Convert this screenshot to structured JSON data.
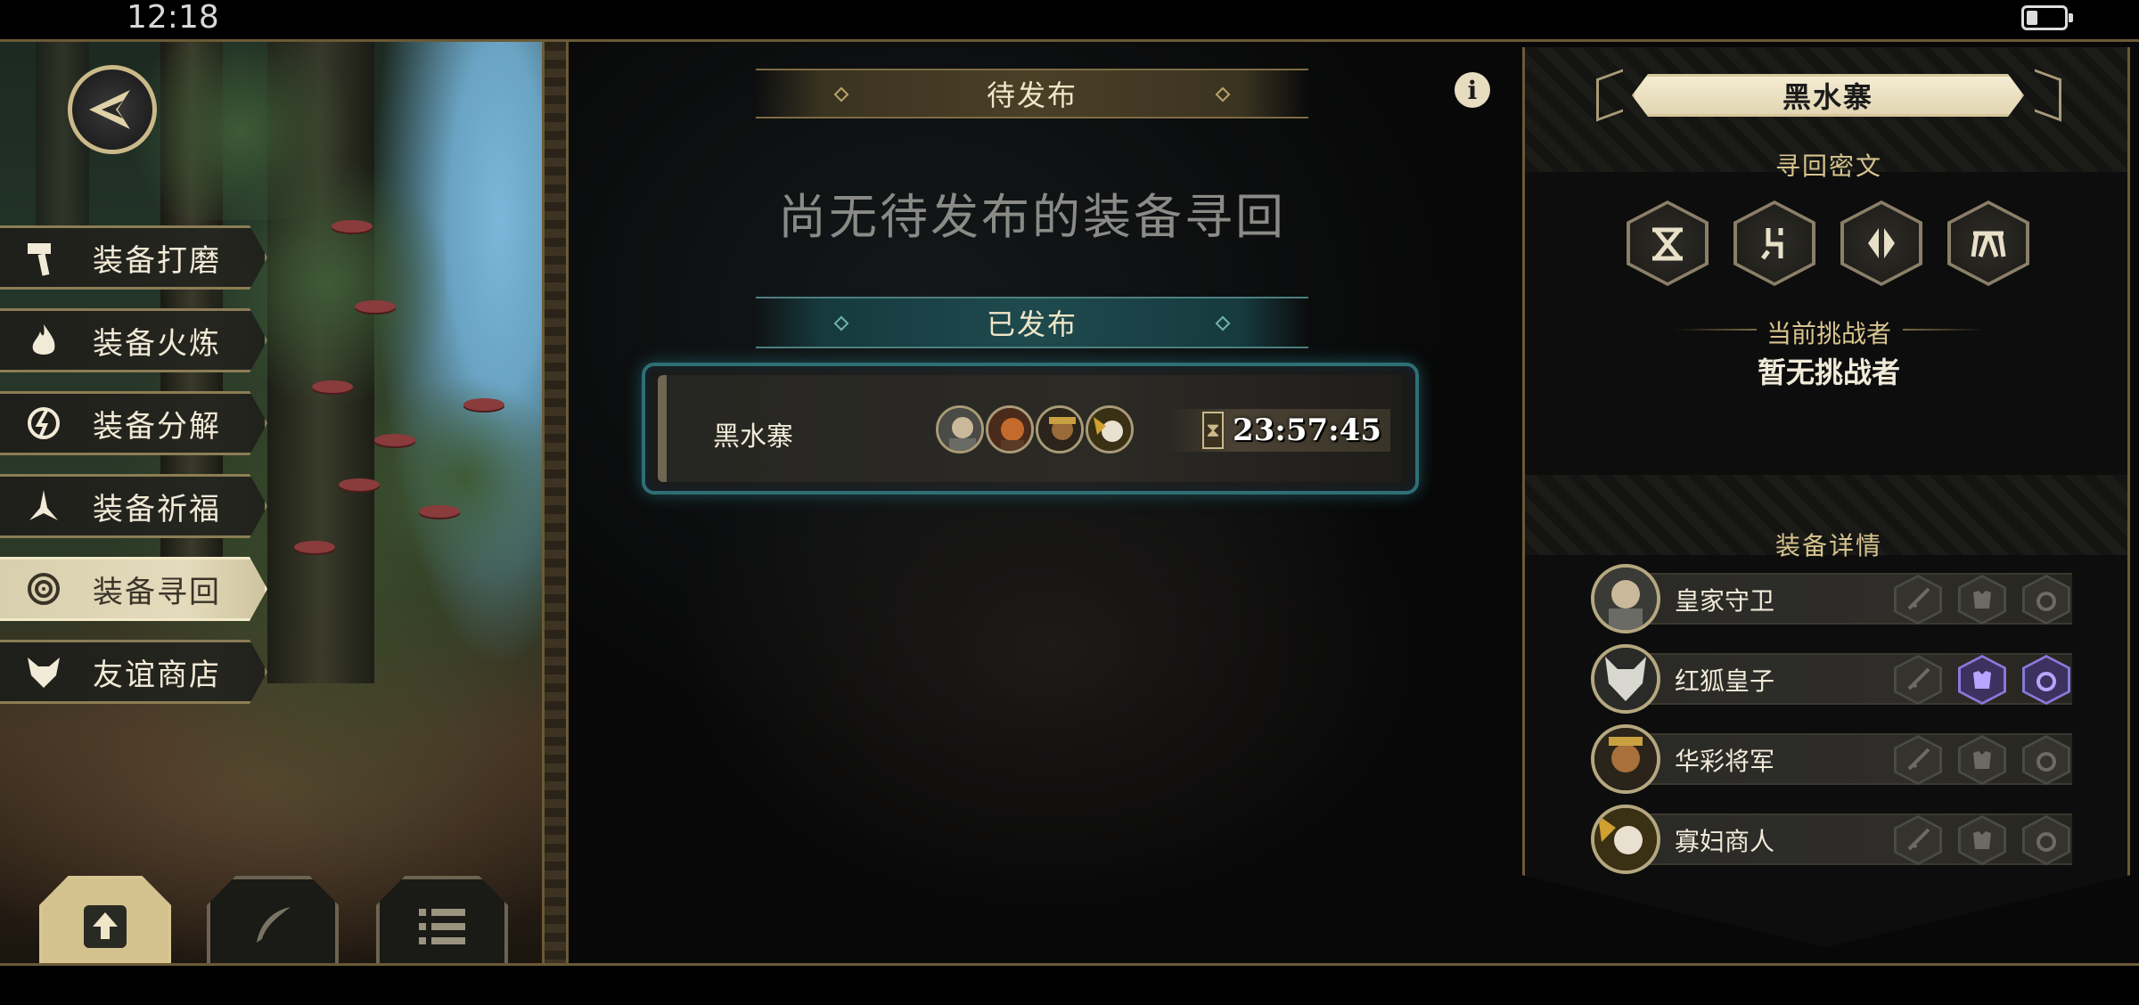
{
  "status_bar": {
    "time": "12:18"
  },
  "sidebar": {
    "items": [
      {
        "label": "装备打磨",
        "icon": "hammer-icon",
        "active": false
      },
      {
        "label": "装备火炼",
        "icon": "flame-icon",
        "active": false
      },
      {
        "label": "装备分解",
        "icon": "decompose-icon",
        "active": false
      },
      {
        "label": "装备祈福",
        "icon": "pray-hands-icon",
        "active": false
      },
      {
        "label": "装备寻回",
        "icon": "spiral-target-icon",
        "active": true
      },
      {
        "label": "友谊商店",
        "icon": "fox-head-icon",
        "active": false
      }
    ],
    "bottom_tabs": [
      {
        "icon": "upload-icon",
        "active": true
      },
      {
        "icon": "feather-icon",
        "active": false
      },
      {
        "icon": "list-icon",
        "active": false
      }
    ]
  },
  "center": {
    "pending_header": "待发布",
    "empty_message": "尚无待发布的装备寻回",
    "published_header": "已发布",
    "quest": {
      "name": "黑水寨",
      "timer": "23:57:45"
    }
  },
  "detail": {
    "title": "黑水寨",
    "runes_label": "寻回密文",
    "runes": [
      "rune-1-icon",
      "rune-2-icon",
      "rune-3-icon",
      "rune-4-icon"
    ],
    "challenger_label": "当前挑战者",
    "challenger_value": "暂无挑战者",
    "equipment_label": "装备详情",
    "heroes": [
      {
        "name": "皇家守卫",
        "slots": [
          false,
          false,
          false
        ]
      },
      {
        "name": "红狐皇子",
        "slots": [
          false,
          true,
          true
        ]
      },
      {
        "name": "华彩将军",
        "slots": [
          false,
          false,
          false
        ]
      },
      {
        "name": "寡妇商人",
        "slots": [
          false,
          false,
          false
        ]
      }
    ]
  },
  "colors": {
    "gold_border": "#6b5a36",
    "teal_accent": "#2f6f74",
    "purple_slot": "#8a78d8"
  }
}
